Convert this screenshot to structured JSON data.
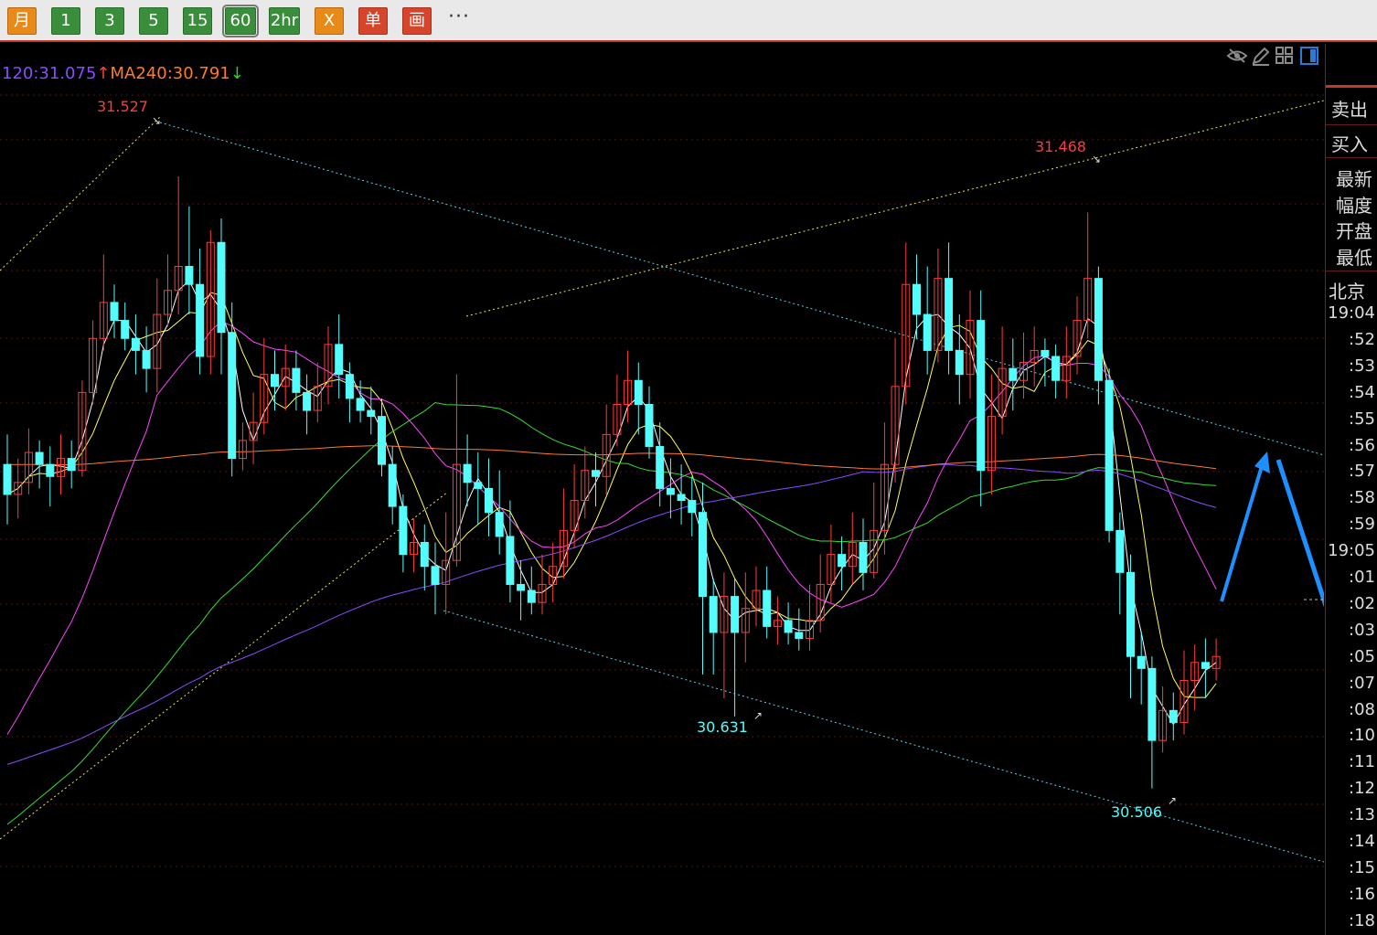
{
  "toolbar": {
    "buttons": [
      {
        "label": "月",
        "style": "orange"
      },
      {
        "label": "1",
        "style": "green"
      },
      {
        "label": "3",
        "style": "green"
      },
      {
        "label": "5",
        "style": "green"
      },
      {
        "label": "15",
        "style": "green"
      },
      {
        "label": "60",
        "style": "green",
        "selected": true
      },
      {
        "label": "2hr",
        "style": "green"
      },
      {
        "label": "X",
        "style": "orange"
      },
      {
        "label": "单",
        "style": "red"
      },
      {
        "label": "画",
        "style": "red"
      }
    ],
    "more_label": "···"
  },
  "ma_legend": {
    "ma120": "120:31.075",
    "ma120_arrow": "↑",
    "ma240": "MA240:30.791",
    "ma240_arrow": "↓",
    "ma120_color": "#8a4bff",
    "ma240_color": "#ff7a29",
    "up_arrow_color": "#ff4040",
    "down_arrow_color": "#2fd02f"
  },
  "chart_icons": [
    "eye-icon",
    "pencil-icon",
    "grid-icon",
    "panel-toggle-icon"
  ],
  "right_panel": {
    "sell_label": "卖出",
    "buy_label": "买入",
    "quote_labels": [
      "最新",
      "幅度",
      "开盘",
      "最低"
    ],
    "region_label": "北京",
    "times": [
      "19:04",
      ":52",
      ":53",
      ":54",
      ":55",
      ":56",
      ":57",
      ":58",
      ":59",
      "19:05",
      ":01",
      ":02",
      ":03",
      ":05",
      ":07",
      ":08",
      ":10",
      ":11",
      ":12",
      ":13",
      ":14",
      ":15",
      ":16",
      ":18"
    ]
  },
  "chart_data": {
    "type": "candlestick",
    "price_range": [
      30.38,
      31.69
    ],
    "colors": {
      "up": "#ff3b3b",
      "down": "#54fcfc",
      "ma5": "#ffffff",
      "ma10": "#ffff55",
      "ma20": "#ff44ff",
      "ma60": "#33dd33",
      "ma120": "#8a4bff",
      "ma240": "#ff7a29",
      "trendline_top": "#e8e85a",
      "trendline_channel": "#5ad2e8",
      "forecast_arrow": "#1e8fff"
    },
    "candles": [
      [
        31.05,
        31.0,
        31.1,
        30.95
      ],
      [
        31.0,
        31.02,
        31.06,
        30.96
      ],
      [
        31.02,
        31.07,
        31.11,
        31.0
      ],
      [
        31.07,
        31.05,
        31.09,
        31.01
      ],
      [
        31.05,
        31.03,
        31.08,
        30.98
      ],
      [
        31.03,
        31.06,
        31.1,
        31.0
      ],
      [
        31.06,
        31.04,
        31.09,
        31.01
      ],
      [
        31.04,
        31.17,
        31.19,
        31.03
      ],
      [
        31.17,
        31.26,
        31.29,
        31.15
      ],
      [
        31.26,
        31.32,
        31.4,
        31.24
      ],
      [
        31.32,
        31.29,
        31.35,
        31.26
      ],
      [
        31.29,
        31.26,
        31.32,
        31.24
      ],
      [
        31.26,
        31.24,
        31.3,
        31.2
      ],
      [
        31.24,
        31.21,
        31.28,
        31.17
      ],
      [
        31.21,
        31.3,
        31.36,
        31.17
      ],
      [
        31.3,
        31.34,
        31.4,
        31.28
      ],
      [
        31.34,
        31.38,
        31.53,
        31.3
      ],
      [
        31.38,
        31.35,
        31.48,
        31.3
      ],
      [
        31.35,
        31.23,
        31.41,
        31.2
      ],
      [
        31.23,
        31.42,
        31.44,
        31.2
      ],
      [
        31.42,
        31.27,
        31.46,
        31.2
      ],
      [
        31.27,
        31.06,
        31.32,
        31.03
      ],
      [
        31.06,
        31.09,
        31.12,
        31.04
      ],
      [
        31.09,
        31.12,
        31.17,
        31.05
      ],
      [
        31.12,
        31.2,
        31.26,
        31.1
      ],
      [
        31.2,
        31.18,
        31.24,
        31.14
      ],
      [
        31.18,
        31.21,
        31.25,
        31.14
      ],
      [
        31.21,
        31.17,
        31.24,
        31.14
      ],
      [
        31.17,
        31.14,
        31.2,
        31.1
      ],
      [
        31.14,
        31.18,
        31.22,
        31.12
      ],
      [
        31.18,
        31.25,
        31.28,
        31.15
      ],
      [
        31.25,
        31.2,
        31.3,
        31.16
      ],
      [
        31.2,
        31.16,
        31.22,
        31.12
      ],
      [
        31.16,
        31.14,
        31.19,
        31.12
      ],
      [
        31.14,
        31.13,
        31.18,
        31.1
      ],
      [
        31.13,
        31.05,
        31.16,
        31.03
      ],
      [
        31.05,
        30.98,
        31.08,
        30.95
      ],
      [
        30.98,
        30.9,
        31.0,
        30.87
      ],
      [
        30.9,
        30.92,
        30.96,
        30.87
      ],
      [
        30.92,
        30.88,
        30.95,
        30.84
      ],
      [
        30.88,
        30.85,
        30.92,
        30.8
      ],
      [
        30.85,
        30.89,
        30.97,
        30.8
      ],
      [
        30.89,
        31.05,
        31.2,
        30.88
      ],
      [
        31.05,
        31.02,
        31.1,
        30.98
      ],
      [
        31.02,
        31.01,
        31.07,
        30.95
      ],
      [
        31.01,
        30.97,
        31.06,
        30.93
      ],
      [
        30.97,
        30.93,
        31.04,
        30.9
      ],
      [
        30.93,
        30.85,
        30.99,
        30.82
      ],
      [
        30.85,
        30.84,
        30.89,
        30.79
      ],
      [
        30.84,
        30.82,
        30.88,
        30.8
      ],
      [
        30.82,
        30.85,
        30.9,
        30.8
      ],
      [
        30.85,
        30.88,
        30.92,
        30.82
      ],
      [
        30.88,
        30.94,
        31.01,
        30.86
      ],
      [
        30.94,
        30.99,
        31.05,
        30.91
      ],
      [
        30.99,
        31.04,
        31.08,
        30.96
      ],
      [
        31.04,
        31.03,
        31.07,
        30.98
      ],
      [
        31.03,
        31.1,
        31.15,
        31.0
      ],
      [
        31.1,
        31.15,
        31.2,
        31.08
      ],
      [
        31.15,
        31.19,
        31.24,
        31.12
      ],
      [
        31.19,
        31.15,
        31.22,
        31.1
      ],
      [
        31.15,
        31.08,
        31.18,
        31.06
      ],
      [
        31.08,
        31.01,
        31.12,
        30.98
      ],
      [
        31.01,
        31.0,
        31.06,
        30.96
      ],
      [
        31.0,
        30.99,
        31.05,
        30.95
      ],
      [
        30.99,
        30.97,
        31.03,
        30.93
      ],
      [
        30.97,
        30.83,
        31.02,
        30.7
      ],
      [
        30.83,
        30.77,
        30.86,
        30.7
      ],
      [
        30.77,
        30.83,
        30.87,
        30.66
      ],
      [
        30.83,
        30.77,
        30.86,
        30.63
      ],
      [
        30.77,
        30.81,
        30.87,
        30.72
      ],
      [
        30.81,
        30.84,
        30.88,
        30.78
      ],
      [
        30.84,
        30.78,
        30.88,
        30.76
      ],
      [
        30.78,
        30.79,
        30.83,
        30.75
      ],
      [
        30.79,
        30.77,
        30.82,
        30.75
      ],
      [
        30.77,
        30.76,
        30.81,
        30.74
      ],
      [
        30.76,
        30.79,
        30.85,
        30.74
      ],
      [
        30.79,
        30.85,
        30.9,
        30.77
      ],
      [
        30.85,
        30.9,
        30.95,
        30.82
      ],
      [
        30.9,
        30.88,
        30.93,
        30.84
      ],
      [
        30.88,
        30.92,
        30.97,
        30.85
      ],
      [
        30.92,
        30.87,
        30.96,
        30.84
      ],
      [
        30.87,
        30.94,
        31.02,
        30.86
      ],
      [
        30.94,
        31.05,
        31.12,
        30.9
      ],
      [
        31.05,
        31.18,
        31.26,
        31.02
      ],
      [
        31.18,
        31.35,
        31.42,
        31.15
      ],
      [
        31.35,
        31.3,
        31.4,
        31.26
      ],
      [
        31.3,
        31.24,
        31.38,
        31.2
      ],
      [
        31.24,
        31.36,
        31.41,
        31.22
      ],
      [
        31.36,
        31.24,
        31.42,
        31.2
      ],
      [
        31.24,
        31.2,
        31.3,
        31.15
      ],
      [
        31.2,
        31.29,
        31.34,
        31.16
      ],
      [
        31.29,
        31.04,
        31.34,
        30.98
      ],
      [
        31.04,
        31.13,
        31.2,
        31.0
      ],
      [
        31.13,
        31.21,
        31.28,
        31.1
      ],
      [
        31.21,
        31.19,
        31.26,
        31.14
      ],
      [
        31.19,
        31.22,
        31.27,
        31.16
      ],
      [
        31.22,
        31.24,
        31.28,
        31.18
      ],
      [
        31.24,
        31.23,
        31.26,
        31.18
      ],
      [
        31.23,
        31.19,
        31.25,
        31.16
      ],
      [
        31.19,
        31.23,
        31.28,
        31.16
      ],
      [
        31.23,
        31.29,
        31.33,
        31.2
      ],
      [
        31.29,
        31.36,
        31.47,
        31.26
      ],
      [
        31.36,
        31.19,
        31.38,
        31.15
      ],
      [
        31.19,
        30.94,
        31.21,
        30.92
      ],
      [
        30.94,
        30.87,
        30.97,
        30.8
      ],
      [
        30.87,
        30.73,
        30.9,
        30.66
      ],
      [
        30.73,
        30.71,
        30.77,
        30.65
      ],
      [
        30.71,
        30.59,
        30.73,
        30.51
      ],
      [
        30.59,
        30.64,
        30.68,
        30.57
      ],
      [
        30.64,
        30.62,
        30.67,
        30.59
      ],
      [
        30.62,
        30.69,
        30.74,
        30.6
      ],
      [
        30.69,
        30.72,
        30.75,
        30.64
      ],
      [
        30.72,
        30.71,
        30.76,
        30.66
      ],
      [
        30.71,
        30.73,
        30.76,
        30.69
      ]
    ],
    "annotations": [
      {
        "label": "31.527",
        "color": "#ff3b3b",
        "type": "high"
      },
      {
        "label": "31.468",
        "color": "#ff3b3b",
        "type": "high"
      },
      {
        "label": "30.631",
        "color": "#54fcfc",
        "type": "low"
      },
      {
        "label": "30.506",
        "color": "#54fcfc",
        "type": "low"
      }
    ],
    "grid": true
  }
}
